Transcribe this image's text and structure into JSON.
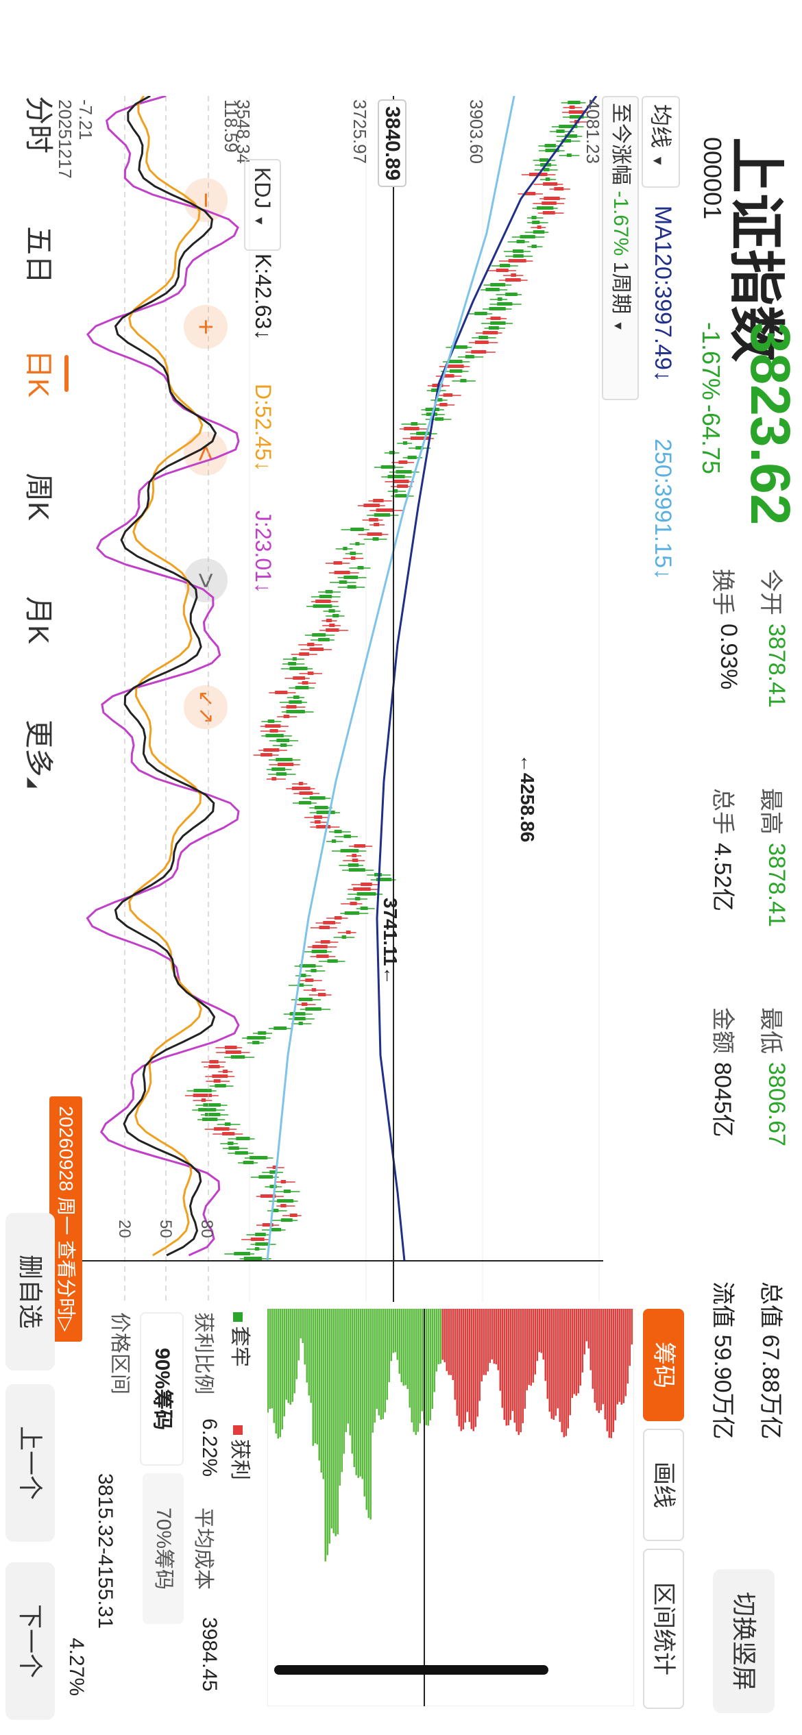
{
  "header": {
    "title": "上证指数",
    "code": "000001",
    "price": "3823.62",
    "change_pct": "-1.67%",
    "change_abs": "-64.75",
    "stats": [
      {
        "label": "今开",
        "value": "3878.41",
        "color": "#2aa52a"
      },
      {
        "label": "最高",
        "value": "3878.41",
        "color": "#2aa52a"
      },
      {
        "label": "最低",
        "value": "3806.67",
        "color": "#2aa52a"
      },
      {
        "label": "换手",
        "value": "0.93%",
        "color": "#222222"
      },
      {
        "label": "总手",
        "value": "4.52亿",
        "color": "#222222"
      },
      {
        "label": "金额",
        "value": "8045亿",
        "color": "#222222"
      }
    ],
    "total_value": "总值 67.88万亿",
    "float_value": "流值 59.90万亿",
    "switch_button": "切换竖屏"
  },
  "ma_bar": {
    "selector": "均线",
    "ma120": "MA120:3997.49↓",
    "ma250": "250:3991.15↓"
  },
  "range_bar": {
    "label": "至今涨幅",
    "value": "-1.67%",
    "period": "1周期"
  },
  "main_chart": {
    "y_labels": [
      "4081.23",
      "3903.60",
      "3725.97",
      "3548.34"
    ],
    "cursor_price": "3840.89",
    "high_label": "←4258.86",
    "low_label": "3741.11←"
  },
  "kdj": {
    "selector": "KDJ",
    "k": "K:42.63↓",
    "d": "D:52.45↓",
    "j": "J:23.01↓",
    "y_top": "118.59",
    "y_bottom": "-7.21",
    "levels": [
      "80",
      "50",
      "20"
    ]
  },
  "x_labels": {
    "start": "20251217",
    "cursor_date": "20260928 周一  查看分时▷"
  },
  "controls": {
    "minus": "−",
    "plus": "+",
    "left": "<",
    "right": ">",
    "shrink": "↙↗"
  },
  "tabs": [
    "分时",
    "五日",
    "日K",
    "周K",
    "月K",
    "更多"
  ],
  "active_tab": "日K",
  "side_tabs": [
    "筹码",
    "画线",
    "区间统计"
  ],
  "chip_panel": {
    "legend_trapped": "套牢",
    "legend_profit": "获利",
    "profit_ratio_label": "获利比例",
    "profit_ratio_value": "6.22%",
    "avg_cost_label": "平均成本",
    "avg_cost_value": "3984.45",
    "chip90": "90%筹码",
    "chip70": "70%筹码",
    "range_label": "价格区间",
    "range_value": "3815.32-4155.31",
    "concentration": "4.27%"
  },
  "bottom_buttons": [
    "删自选",
    "上一个",
    "下一个"
  ],
  "colors": {
    "up": "#e03c3c",
    "down": "#2aa52a",
    "accent": "#f0600e",
    "ma120": "#1f2f8a",
    "ma250": "#7ec4ea",
    "k": "#222222",
    "d": "#f0a020",
    "j": "#c040c8"
  }
}
